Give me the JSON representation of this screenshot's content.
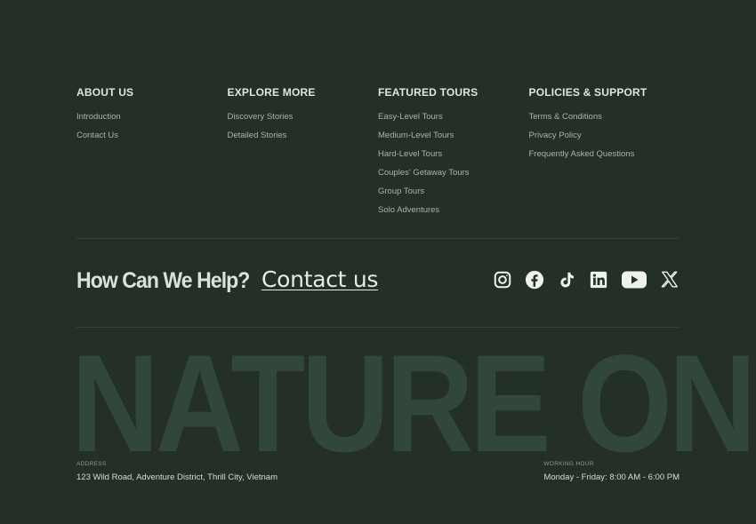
{
  "columns": [
    {
      "heading": "ABOUT US",
      "links": [
        "Introduction",
        "Contact Us"
      ]
    },
    {
      "heading": "EXPLORE MORE",
      "links": [
        "Discovery Stories",
        "Detailed Stories"
      ]
    },
    {
      "heading": "FEATURED TOURS",
      "links": [
        "Easy-Level Tours",
        "Medium-Level Tours",
        "Hard-Level Tours",
        "Couples' Getaway Tours",
        "Group Tours",
        "Solo Adventures"
      ]
    },
    {
      "heading": "POLICIES & SUPPORT",
      "links": [
        "Terms & Conditions",
        "Privacy Policy",
        "Frequently Asked Questions"
      ]
    }
  ],
  "help": {
    "title": "How Can We Help?",
    "contact_label": "Contact us"
  },
  "socials": [
    {
      "icon": "instagram-icon"
    },
    {
      "icon": "facebook-icon"
    },
    {
      "icon": "tiktok-icon"
    },
    {
      "icon": "linkedin-icon"
    },
    {
      "icon": "youtube-icon"
    },
    {
      "icon": "x-icon"
    }
  ],
  "brand_word": "NATURE ON",
  "address": {
    "label": "ADDRESS",
    "value": "123 Wild Road, Adventure District, Thrill City, Vietnam"
  },
  "working_hour": {
    "label": "WORKING HOUR",
    "value": "Monday - Friday: 8:00 AM - 6:00 PM"
  },
  "colors": {
    "background": "#232f27",
    "brand_word": "#31473a",
    "heading": "#dfe5df",
    "link": "#a9b4aa"
  }
}
